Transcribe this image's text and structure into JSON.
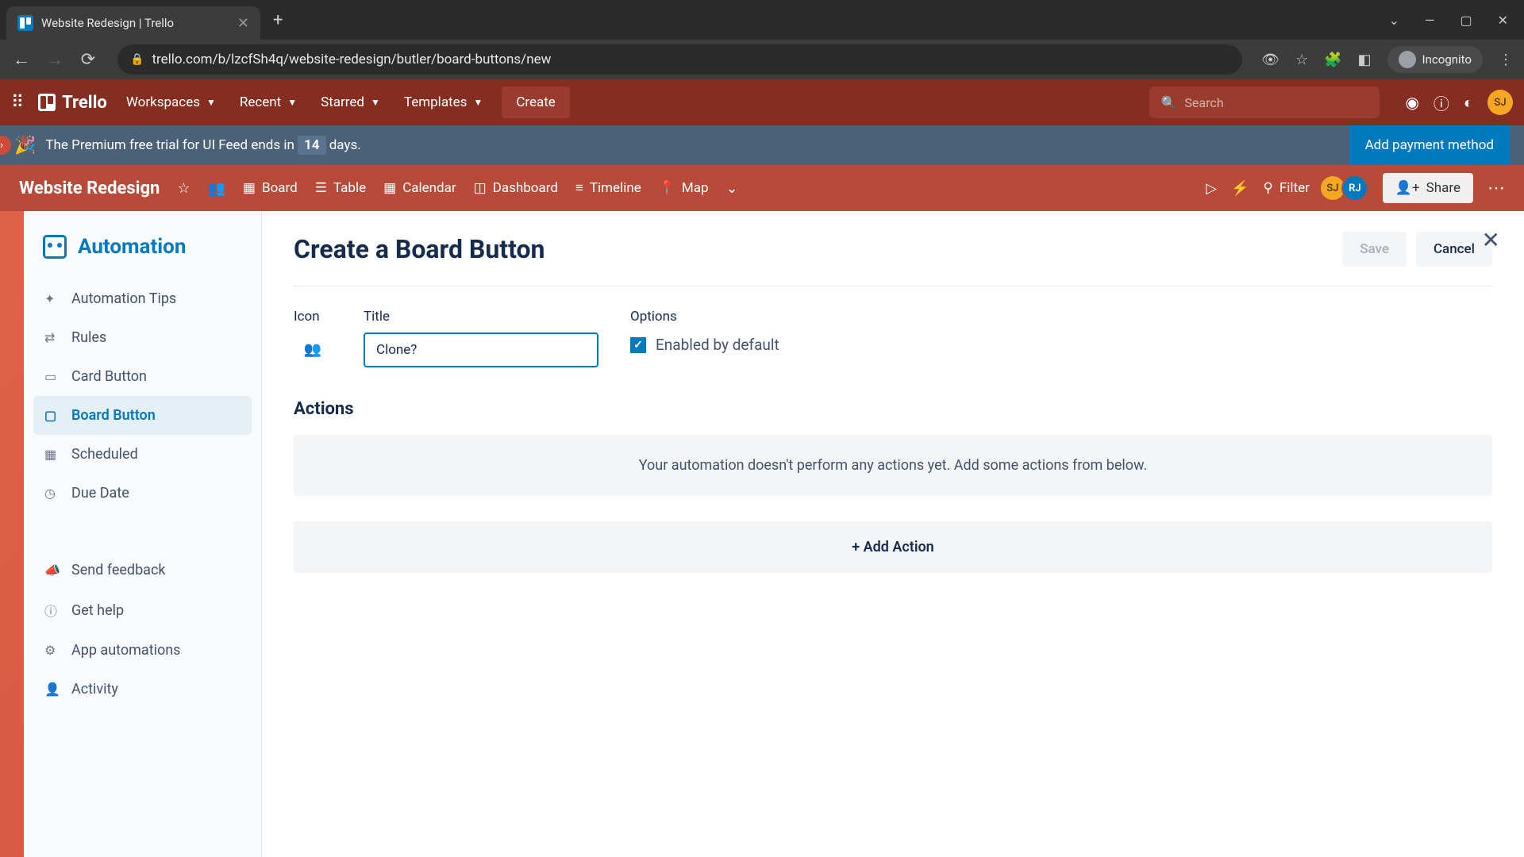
{
  "browser": {
    "tab_title": "Website Redesign | Trello",
    "url": "trello.com/b/lzcfSh4q/website-redesign/butler/board-buttons/new",
    "incognito_label": "Incognito"
  },
  "trello_header": {
    "logo": "Trello",
    "menus": {
      "workspaces": "Workspaces",
      "recent": "Recent",
      "starred": "Starred",
      "templates": "Templates"
    },
    "create": "Create",
    "search_placeholder": "Search",
    "avatar_initials": "SJ"
  },
  "banner": {
    "text_pre": "The Premium free trial for UI Feed ends in",
    "days": "14",
    "text_post": "days.",
    "cta": "Add payment method"
  },
  "board_bar": {
    "title": "Website Redesign",
    "views": {
      "board": "Board",
      "table": "Table",
      "calendar": "Calendar",
      "dashboard": "Dashboard",
      "timeline": "Timeline",
      "map": "Map"
    },
    "filter": "Filter",
    "members": {
      "sj": "SJ",
      "rj": "RJ"
    },
    "share": "Share"
  },
  "sidebar": {
    "title": "Automation",
    "items": {
      "tips": "Automation Tips",
      "rules": "Rules",
      "card_button": "Card Button",
      "board_button": "Board Button",
      "scheduled": "Scheduled",
      "due_date": "Due Date",
      "feedback": "Send feedback",
      "help": "Get help",
      "app_auto": "App automations",
      "activity": "Activity"
    }
  },
  "panel": {
    "title": "Create a Board Button",
    "save": "Save",
    "cancel": "Cancel",
    "icon_label": "Icon",
    "title_label": "Title",
    "title_value": "Clone?",
    "options_label": "Options",
    "enabled_label": "Enabled by default",
    "actions_heading": "Actions",
    "empty_text": "Your automation doesn't perform any actions yet. Add some actions from below.",
    "add_action": "+ Add Action"
  }
}
